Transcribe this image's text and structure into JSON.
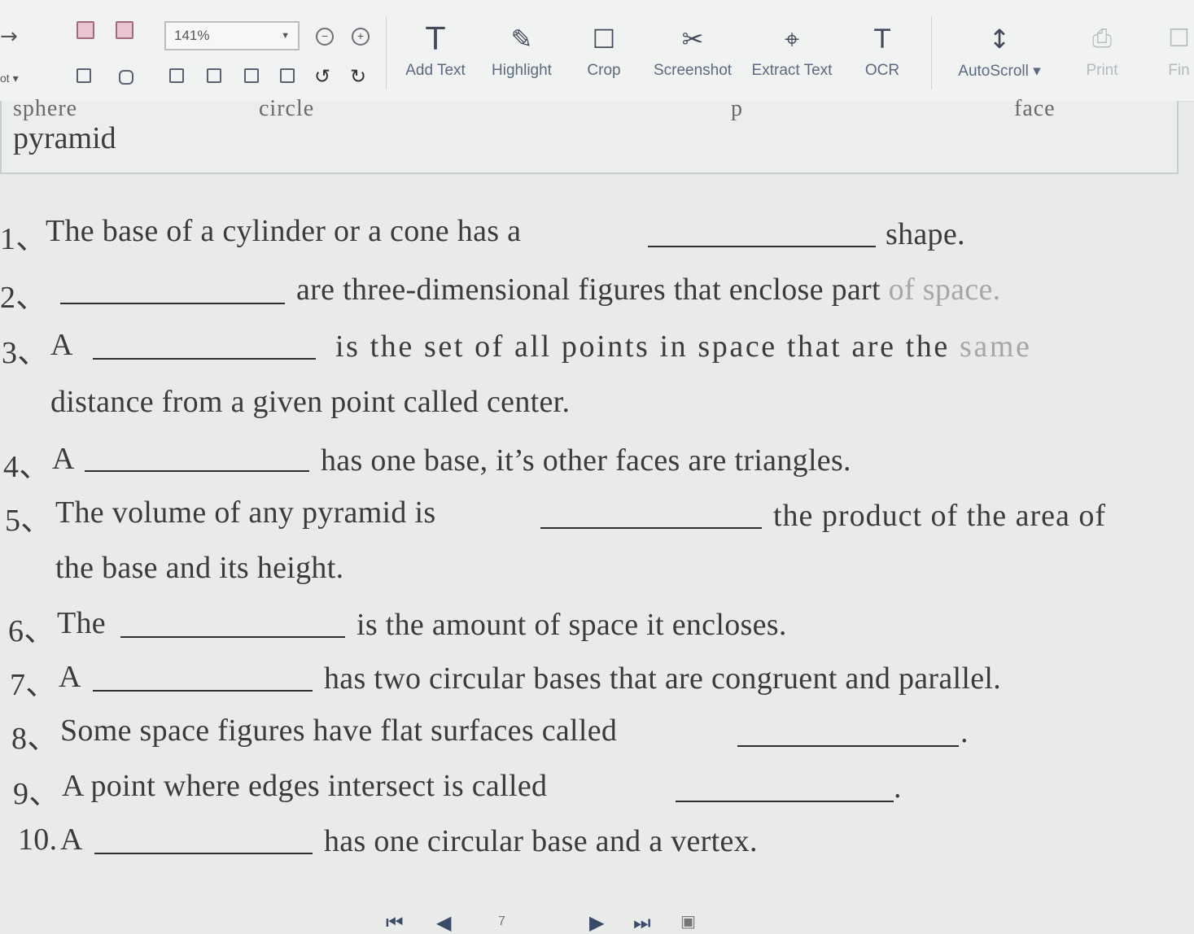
{
  "toolbar": {
    "left_cut_label": "ot ▾",
    "zoom_value": "141%",
    "tools": [
      {
        "label": "Add Text",
        "icon": "text-icon"
      },
      {
        "label": "Highlight",
        "icon": "highlight-icon"
      },
      {
        "label": "Crop",
        "icon": "crop-icon"
      },
      {
        "label": "Screenshot",
        "icon": "screenshot-icon"
      },
      {
        "label": "Extract Text",
        "icon": "extract-text-icon"
      },
      {
        "label": "OCR",
        "icon": "ocr-icon"
      },
      {
        "label": "AutoScroll ▾",
        "icon": "autoscroll-icon"
      },
      {
        "label": "Print",
        "icon": "print-icon"
      },
      {
        "label": "Fin",
        "icon": "find-icon"
      }
    ]
  },
  "wordbank": {
    "cut_words": [
      "sphere",
      "circle",
      "p",
      "face"
    ],
    "visible_word": "pyramid"
  },
  "questions": [
    {
      "num": "1、",
      "before": "The base of a cylinder or a cone has a",
      "after": "shape.",
      "after_faded": ""
    },
    {
      "num": "2、",
      "before": "",
      "after": "are three-dimensional figures that enclose part ",
      "after_faded": "of space."
    },
    {
      "num": "3、",
      "before": "A",
      "after": "is the set of all points in space that are the ",
      "after_faded": "same"
    },
    {
      "num": "",
      "before": "distance from a given point called center.",
      "after": "",
      "after_faded": ""
    },
    {
      "num": "4、",
      "before": "A",
      "after": "has one base, it’s other faces are triangles.",
      "after_faded": ""
    },
    {
      "num": "5、",
      "before": "The volume of any pyramid is",
      "after": "the product of the area of",
      "after_faded": ""
    },
    {
      "num": "",
      "before": "the base and its height.",
      "after": "",
      "after_faded": ""
    },
    {
      "num": "6、",
      "before": "The",
      "after": "is the amount of space it encloses.",
      "after_faded": ""
    },
    {
      "num": "7、",
      "before": "A",
      "after": "has two circular bases that are congruent and parallel.",
      "after_faded": ""
    },
    {
      "num": "8、",
      "before": "Some space figures have flat surfaces called",
      "after": ".",
      "after_faded": ""
    },
    {
      "num": "9、",
      "before": "A point where edges intersect is called",
      "after": ".",
      "after_faded": ""
    },
    {
      "num": "10.",
      "before": "A",
      "after": "has one circular base and a vertex.",
      "after_faded": ""
    }
  ],
  "nav": {
    "first": "⏮",
    "prev": "◀",
    "page": "7",
    "next": "▶",
    "last": "⏭"
  }
}
